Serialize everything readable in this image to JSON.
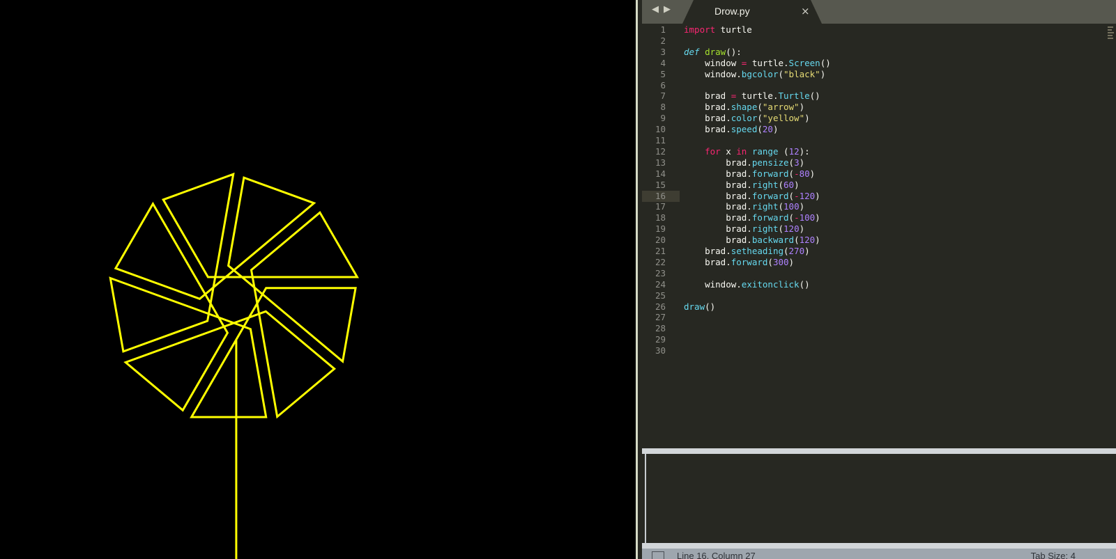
{
  "turtle_window": {
    "background": "#000000",
    "pen_color": "#ffff00"
  },
  "editor": {
    "tab": {
      "title": "Drow.py",
      "close_glyph": "×",
      "back_glyph": "◀",
      "forward_glyph": "▶"
    },
    "current_line": 16,
    "lines": [
      {
        "n": "1",
        "tokens": [
          [
            "kw",
            "import"
          ],
          [
            "txt",
            " turtle"
          ]
        ]
      },
      {
        "n": "2",
        "tokens": []
      },
      {
        "n": "3",
        "tokens": [
          [
            "def",
            "def"
          ],
          [
            "txt",
            " "
          ],
          [
            "fn",
            "draw"
          ],
          [
            "txt",
            "():"
          ]
        ]
      },
      {
        "n": "4",
        "tokens": [
          [
            "txt",
            "    window "
          ],
          [
            "kw",
            "="
          ],
          [
            "txt",
            " turtle."
          ],
          [
            "call",
            "Screen"
          ],
          [
            "txt",
            "()"
          ]
        ]
      },
      {
        "n": "5",
        "tokens": [
          [
            "txt",
            "    window."
          ],
          [
            "call",
            "bgcolor"
          ],
          [
            "txt",
            "("
          ],
          [
            "str",
            "\"black\""
          ],
          [
            "txt",
            ")"
          ]
        ]
      },
      {
        "n": "6",
        "tokens": []
      },
      {
        "n": "7",
        "tokens": [
          [
            "txt",
            "    brad "
          ],
          [
            "kw",
            "="
          ],
          [
            "txt",
            " turtle."
          ],
          [
            "call",
            "Turtle"
          ],
          [
            "txt",
            "()"
          ]
        ]
      },
      {
        "n": "8",
        "tokens": [
          [
            "txt",
            "    brad."
          ],
          [
            "call",
            "shape"
          ],
          [
            "txt",
            "("
          ],
          [
            "str",
            "\"arrow\""
          ],
          [
            "txt",
            ")"
          ]
        ]
      },
      {
        "n": "9",
        "tokens": [
          [
            "txt",
            "    brad."
          ],
          [
            "call",
            "color"
          ],
          [
            "txt",
            "("
          ],
          [
            "str",
            "\"yellow\""
          ],
          [
            "txt",
            ")"
          ]
        ]
      },
      {
        "n": "10",
        "tokens": [
          [
            "txt",
            "    brad."
          ],
          [
            "call",
            "speed"
          ],
          [
            "txt",
            "("
          ],
          [
            "num",
            "20"
          ],
          [
            "txt",
            ")"
          ]
        ]
      },
      {
        "n": "11",
        "tokens": []
      },
      {
        "n": "12",
        "tokens": [
          [
            "txt",
            "    "
          ],
          [
            "kw",
            "for"
          ],
          [
            "txt",
            " x "
          ],
          [
            "kw",
            "in"
          ],
          [
            "txt",
            " "
          ],
          [
            "call",
            "range"
          ],
          [
            "txt",
            " ("
          ],
          [
            "num",
            "12"
          ],
          [
            "txt",
            "):"
          ]
        ]
      },
      {
        "n": "13",
        "tokens": [
          [
            "txt",
            "        brad."
          ],
          [
            "call",
            "pensize"
          ],
          [
            "txt",
            "("
          ],
          [
            "num",
            "3"
          ],
          [
            "txt",
            ")"
          ]
        ]
      },
      {
        "n": "14",
        "tokens": [
          [
            "txt",
            "        brad."
          ],
          [
            "call",
            "forward"
          ],
          [
            "txt",
            "("
          ],
          [
            "kw",
            "-"
          ],
          [
            "num",
            "80"
          ],
          [
            "txt",
            ")"
          ]
        ]
      },
      {
        "n": "15",
        "tokens": [
          [
            "txt",
            "        brad."
          ],
          [
            "call",
            "right"
          ],
          [
            "txt",
            "("
          ],
          [
            "num",
            "60"
          ],
          [
            "txt",
            ")"
          ]
        ]
      },
      {
        "n": "16",
        "tokens": [
          [
            "txt",
            "        brad."
          ],
          [
            "call",
            "forward"
          ],
          [
            "txt",
            "("
          ],
          [
            "kw",
            "-"
          ],
          [
            "num",
            "120"
          ],
          [
            "txt",
            ")"
          ]
        ]
      },
      {
        "n": "17",
        "tokens": [
          [
            "txt",
            "        brad."
          ],
          [
            "call",
            "right"
          ],
          [
            "txt",
            "("
          ],
          [
            "num",
            "100"
          ],
          [
            "txt",
            ")"
          ]
        ]
      },
      {
        "n": "18",
        "tokens": [
          [
            "txt",
            "        brad."
          ],
          [
            "call",
            "forward"
          ],
          [
            "txt",
            "("
          ],
          [
            "kw",
            "-"
          ],
          [
            "num",
            "100"
          ],
          [
            "txt",
            ")"
          ]
        ]
      },
      {
        "n": "19",
        "tokens": [
          [
            "txt",
            "        brad."
          ],
          [
            "call",
            "right"
          ],
          [
            "txt",
            "("
          ],
          [
            "num",
            "120"
          ],
          [
            "txt",
            ")"
          ]
        ]
      },
      {
        "n": "20",
        "tokens": [
          [
            "txt",
            "        brad."
          ],
          [
            "call",
            "backward"
          ],
          [
            "txt",
            "("
          ],
          [
            "num",
            "120"
          ],
          [
            "txt",
            ")"
          ]
        ]
      },
      {
        "n": "21",
        "tokens": [
          [
            "txt",
            "    brad."
          ],
          [
            "call",
            "setheading"
          ],
          [
            "txt",
            "("
          ],
          [
            "num",
            "270"
          ],
          [
            "txt",
            ")"
          ]
        ]
      },
      {
        "n": "22",
        "tokens": [
          [
            "txt",
            "    brad."
          ],
          [
            "call",
            "forward"
          ],
          [
            "txt",
            "("
          ],
          [
            "num",
            "300"
          ],
          [
            "txt",
            ")"
          ]
        ]
      },
      {
        "n": "23",
        "tokens": []
      },
      {
        "n": "24",
        "tokens": [
          [
            "txt",
            "    window."
          ],
          [
            "call",
            "exitonclick"
          ],
          [
            "txt",
            "()"
          ]
        ]
      },
      {
        "n": "25",
        "tokens": []
      },
      {
        "n": "26",
        "tokens": [
          [
            "call",
            "draw"
          ],
          [
            "txt",
            "()"
          ]
        ]
      },
      {
        "n": "27",
        "tokens": []
      },
      {
        "n": "28",
        "tokens": []
      },
      {
        "n": "29",
        "tokens": []
      },
      {
        "n": "30",
        "tokens": []
      }
    ]
  },
  "status_bar": {
    "position": "Line 16, Column 27",
    "tab_size": "Tab Size: 4"
  },
  "colors": {
    "editor_bg": "#272822",
    "keyword": "#f92672",
    "function": "#a6e22e",
    "builtin": "#66d9ef",
    "string": "#e6db74",
    "number": "#ae81ff",
    "text": "#f8f8f2",
    "line_number": "#90908a"
  }
}
